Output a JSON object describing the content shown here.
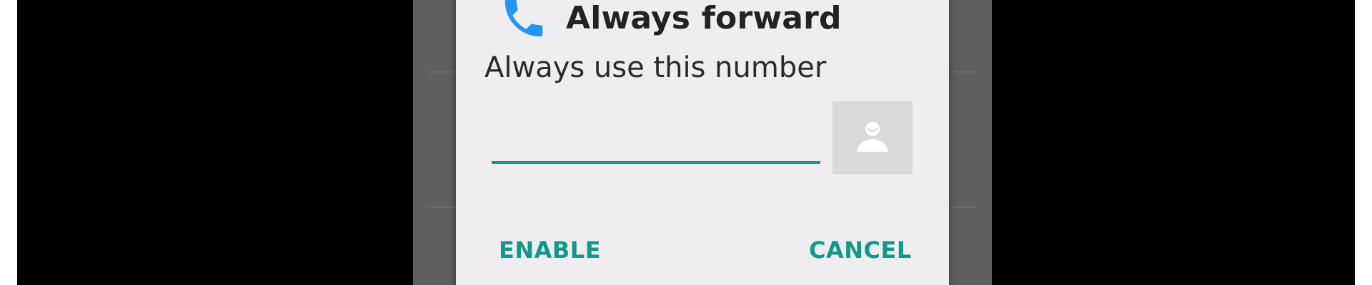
{
  "dialog": {
    "title": "Always forward",
    "message": "Always use this number",
    "number_input": {
      "value": "",
      "placeholder": ""
    },
    "buttons": {
      "enable_label": "ENABLE",
      "cancel_label": "CANCEL"
    },
    "icons": {
      "header_icon": "phone-icon",
      "contact_icon": "contact-picker-icon"
    }
  },
  "colors": {
    "accent": "#14978a",
    "phone_icon": "#2196f3",
    "dialog_background": "#efedf0",
    "scrim": "#5f5e60"
  }
}
